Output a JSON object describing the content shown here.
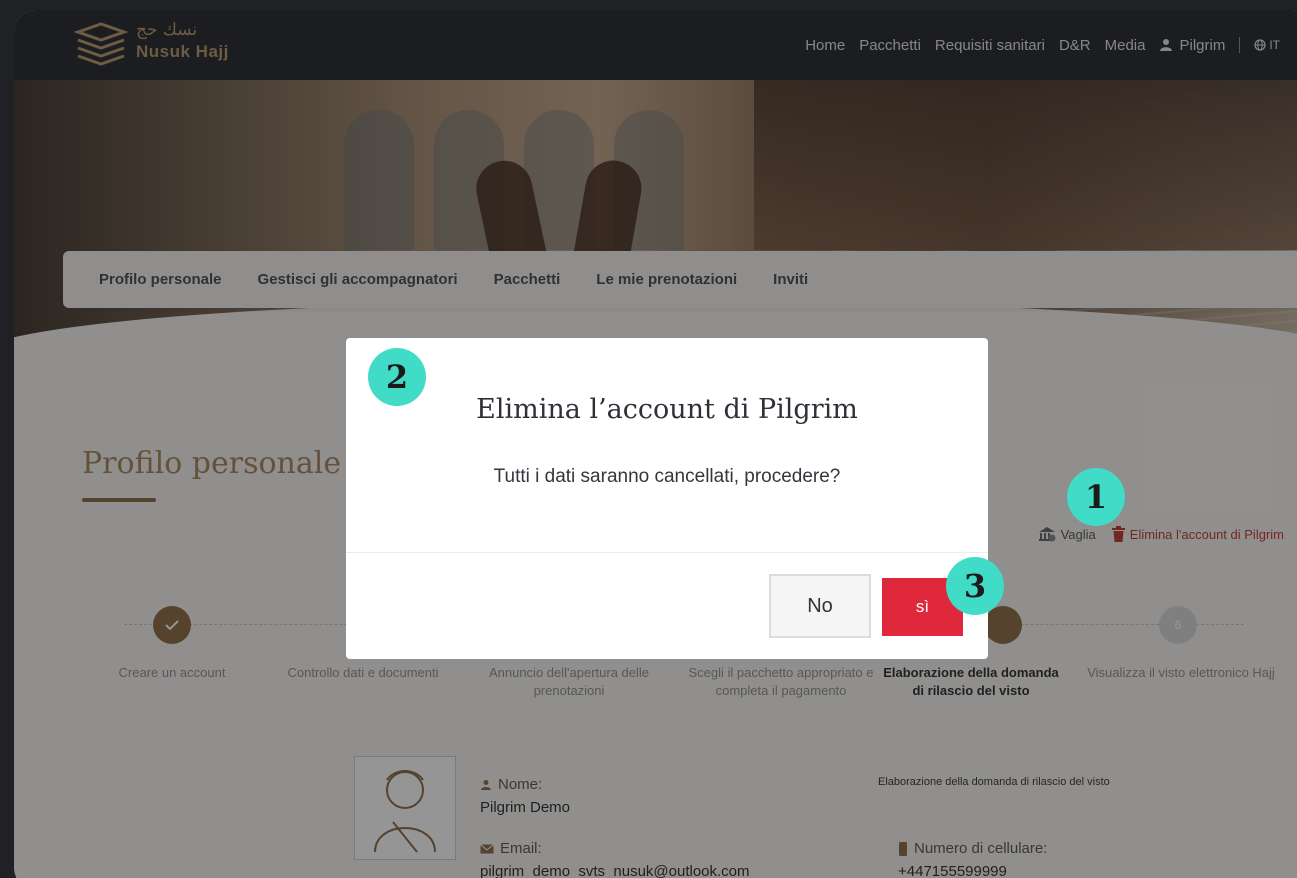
{
  "header": {
    "logo_arabic": "نسك حج",
    "logo_text": "Nusuk Hajj",
    "nav": [
      "Home",
      "Pacchetti",
      "Requisiti sanitari",
      "D&R",
      "Media"
    ],
    "user": "Pilgrim",
    "lang": "IT"
  },
  "tabs": [
    "Profilo personale",
    "Gestisci gli accompagnatori",
    "Pacchetti",
    "Le mie prenotazioni",
    "Inviti"
  ],
  "page": {
    "title": "Profilo personale",
    "actions": {
      "vaglia": "Vaglia",
      "delete": "Elimina l'account di Pilgrim"
    }
  },
  "steps": [
    {
      "num": "",
      "label": "Creare un account",
      "state": "done"
    },
    {
      "num": "",
      "label": "Controllo dati e documenti",
      "state": "done"
    },
    {
      "num": "",
      "label": "Annuncio dell'apertura delle prenotazioni",
      "state": "done"
    },
    {
      "num": "",
      "label": "Scegli il pacchetto appropriato e completa il pagamento",
      "state": "done"
    },
    {
      "num": "",
      "label": "Elaborazione della domanda di rilascio del visto",
      "state": "active"
    },
    {
      "num": "6",
      "label": "Visualizza il visto elettronico Hajj",
      "state": "pending"
    }
  ],
  "profile": {
    "name_label": "Nome:",
    "name_value": "Pilgrim Demo",
    "email_label": "Email:",
    "email_value": "pilgrim_demo_svts_nusuk@outlook.com",
    "status_text": "Elaborazione della domanda di rilascio del visto",
    "phone_label": "Numero di cellulare:",
    "phone_value": "+447155599999"
  },
  "modal": {
    "title": "Elimina l’account di Pilgrim",
    "message": "Tutti i dati saranno cancellati, procedere?",
    "no_label": "No",
    "yes_label": "sì"
  },
  "markers": [
    "1",
    "2",
    "3"
  ],
  "colors": {
    "accent": "#a5835e",
    "danger": "#e0283d",
    "marker": "#40dcc8"
  }
}
